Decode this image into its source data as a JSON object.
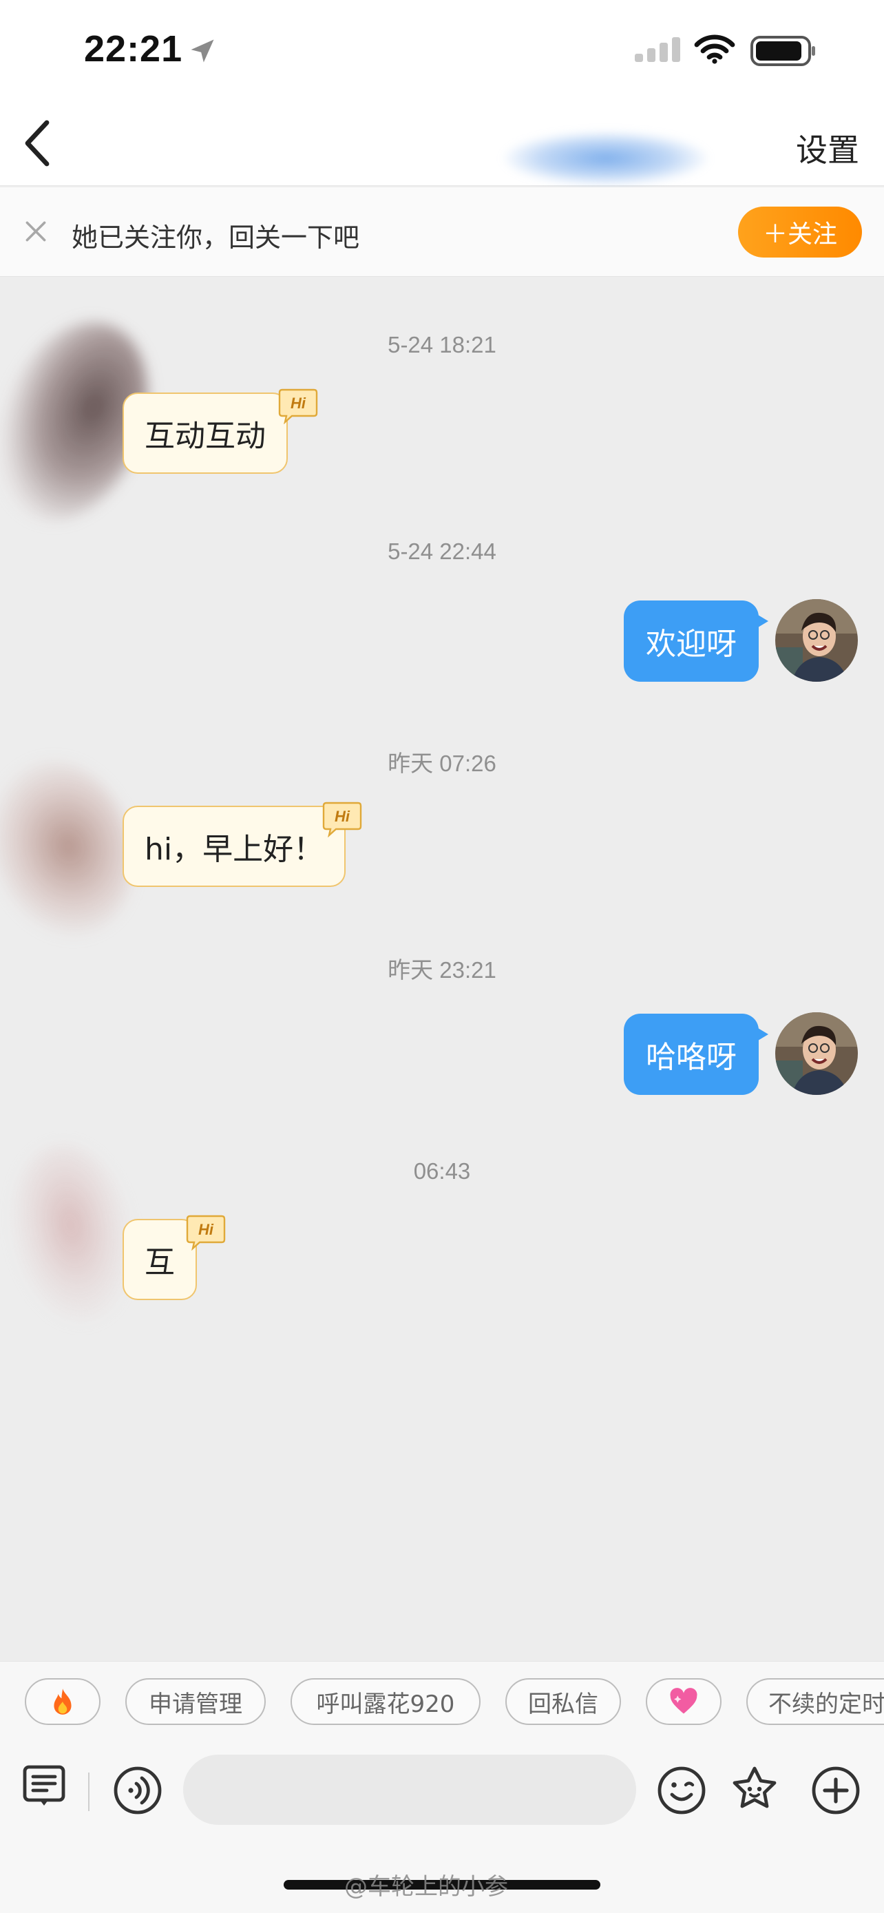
{
  "status_bar": {
    "time": "22:21",
    "icons": [
      "location-arrow-icon",
      "cellular-signal-icon",
      "wifi-icon",
      "battery-icon"
    ]
  },
  "header": {
    "back_icon": "chevron-left-icon",
    "settings_label": "设置"
  },
  "banner": {
    "text": "她已关注你，回关一下吧",
    "follow_label": "＋关注",
    "close_icon": "close-icon",
    "accent": "#ff9500"
  },
  "messages": [
    {
      "timestamp": "5-24 18:21",
      "direction": "incoming",
      "text": "互动互动",
      "badge": "Hi"
    },
    {
      "timestamp": "5-24 22:44",
      "direction": "outgoing",
      "text": "欢迎呀"
    },
    {
      "timestamp": "昨天 07:26",
      "direction": "incoming",
      "text": "hi，早上好！",
      "badge": "Hi"
    },
    {
      "timestamp": "昨天 23:21",
      "direction": "outgoing",
      "text": "哈咯呀"
    },
    {
      "timestamp": "06:43",
      "direction": "incoming",
      "text": "互",
      "badge": "Hi"
    }
  ],
  "quick_chips": [
    {
      "label": "",
      "icon": "fire-emoji"
    },
    {
      "label": "申请管理"
    },
    {
      "label": "呼叫露花920"
    },
    {
      "label": "回私信"
    },
    {
      "label": "",
      "icon": "sparkling-heart-emoji"
    },
    {
      "label": "不续的定时"
    }
  ],
  "input_bar": {
    "placeholder": "",
    "icons": [
      "note-icon",
      "voice-icon",
      "emoji-face-icon",
      "sticker-icon",
      "add-icon"
    ]
  },
  "watermark": "@车轮上的小参",
  "colors": {
    "outgoing_bubble": "#3d9ef5",
    "incoming_bubble": "#fffaea",
    "incoming_border": "#f0c56e",
    "chat_background": "#ededed"
  }
}
